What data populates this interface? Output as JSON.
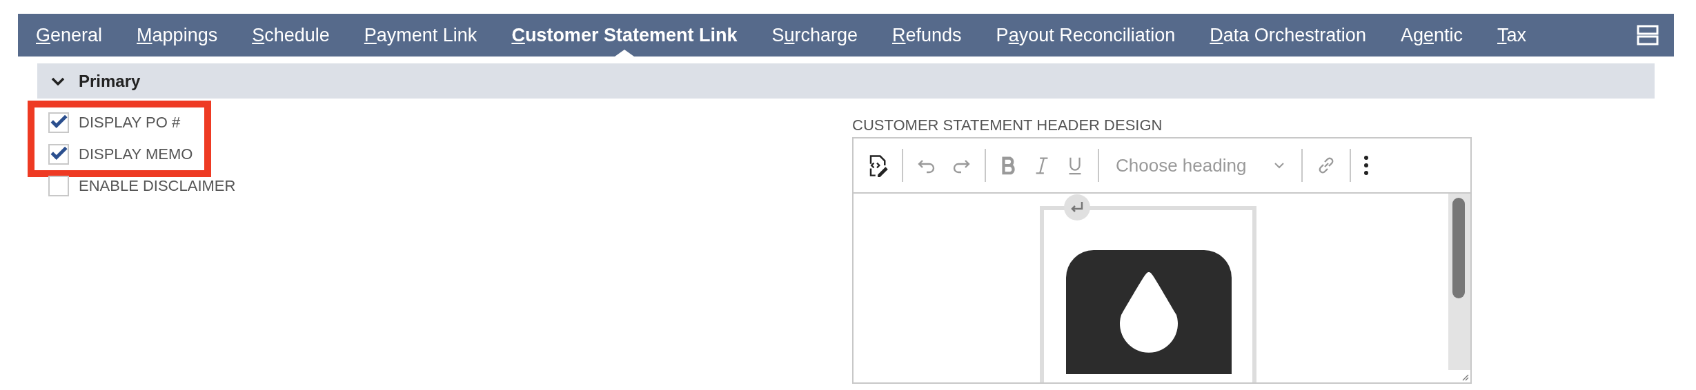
{
  "tabs": [
    {
      "access_key": "G",
      "suffix": "eneral",
      "selected": false
    },
    {
      "access_key": "M",
      "suffix": "appings",
      "selected": false
    },
    {
      "access_key": "S",
      "suffix": "chedule",
      "selected": false
    },
    {
      "access_key": "P",
      "suffix": "ayment Link",
      "selected": false
    },
    {
      "access_key": "C",
      "suffix": "ustomer Statement Link",
      "selected": true
    },
    {
      "prefix": "S",
      "access_key": "u",
      "suffix": "rcharge",
      "selected": false
    },
    {
      "access_key": "R",
      "suffix": "efunds",
      "selected": false
    },
    {
      "prefix": "P",
      "access_key": "a",
      "suffix": "yout Reconciliation",
      "selected": false
    },
    {
      "access_key": "D",
      "suffix": "ata Orchestration",
      "selected": false
    },
    {
      "prefix": "Ag",
      "access_key": "e",
      "suffix": "ntic",
      "selected": false
    },
    {
      "access_key": "T",
      "suffix": "ax",
      "selected": false
    }
  ],
  "section": {
    "title": "Primary",
    "expanded": true
  },
  "options": [
    {
      "label": "DISPLAY PO #",
      "checked": true,
      "highlighted": true
    },
    {
      "label": "DISPLAY MEMO",
      "checked": true,
      "highlighted": true
    },
    {
      "label": "ENABLE DISCLAIMER",
      "checked": false,
      "highlighted": false
    }
  ],
  "editor": {
    "label": "CUSTOMER STATEMENT HEADER DESIGN",
    "heading_select": {
      "placeholder": "Choose heading"
    }
  }
}
